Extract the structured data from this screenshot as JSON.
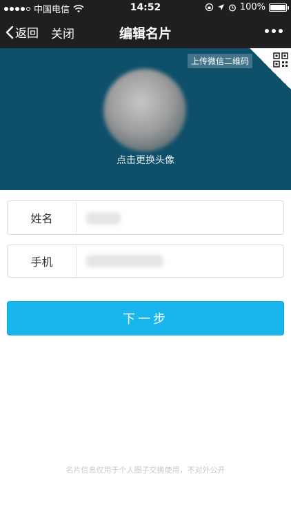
{
  "status_bar": {
    "carrier": "中国电信",
    "time": "14:52",
    "battery": "100%",
    "signal_bars_filled": 4,
    "signal_bars_total": 5,
    "battery_level_fraction": 1.0
  },
  "nav": {
    "back_label": "返回",
    "close_label": "关闭",
    "title": "编辑名片"
  },
  "header": {
    "qr_label": "上传微信二维码",
    "avatar_caption": "点击更换头像",
    "bg_color": "#0e4f6a"
  },
  "form": {
    "name_label": "姓名",
    "phone_label": "手机"
  },
  "next_button": {
    "label": "下一步",
    "color": "#18b6ec"
  },
  "footer": {
    "note": "名片信息仅用于个人圈子交换使用，不对外公开"
  }
}
